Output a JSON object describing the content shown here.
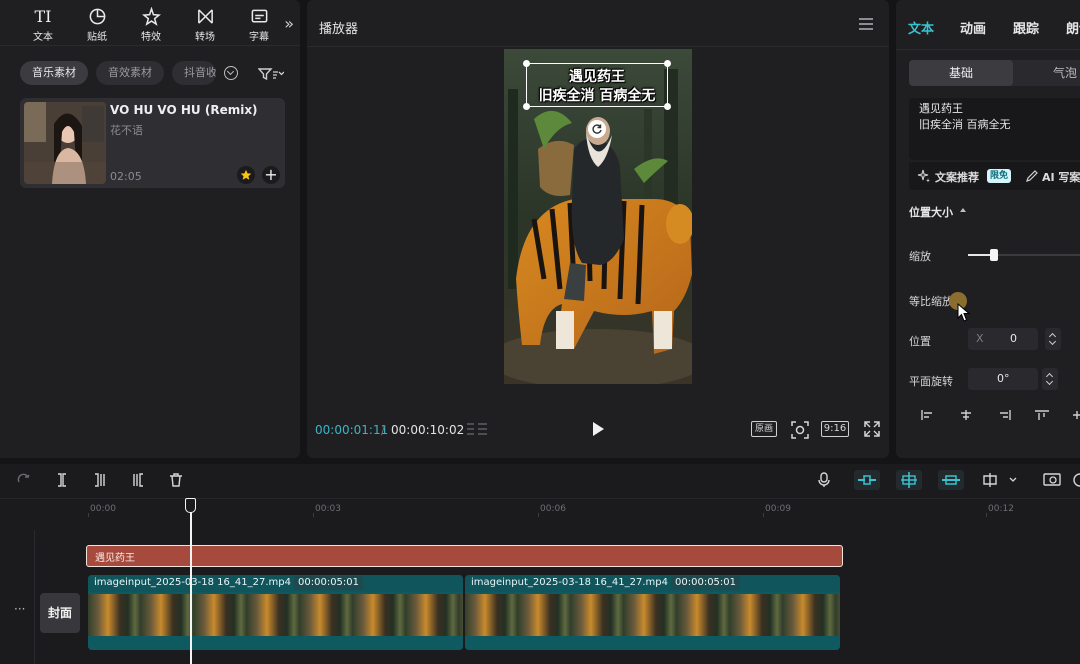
{
  "toolbar": {
    "items": [
      {
        "label": "文本",
        "icon": "text-icon"
      },
      {
        "label": "贴纸",
        "icon": "sticker-icon"
      },
      {
        "label": "特效",
        "icon": "effects-icon"
      },
      {
        "label": "转场",
        "icon": "transition-icon"
      },
      {
        "label": "字幕",
        "icon": "subtitle-icon"
      }
    ],
    "more_icon": "»"
  },
  "media_chips": [
    "音乐素材",
    "音效素材",
    "抖音收"
  ],
  "music": {
    "title": "VO HU VO HU (Remix)",
    "artist": "花不语",
    "duration": "02:05"
  },
  "player": {
    "title": "播放器",
    "caption_line1": "遇见药王",
    "caption_line2": "旧疾全消 百病全无",
    "time_current": "00:00:01:11",
    "time_separator": "/",
    "time_total": "00:00:10:02",
    "original_label": "原画",
    "ratio_label": "9:16"
  },
  "inspector": {
    "tabs": [
      "文本",
      "动画",
      "跟踪",
      "朗读"
    ],
    "sub_tab_basic": "基础",
    "sub_tab_bubble": "气泡",
    "text_line1": "遇见药王",
    "text_line2": "旧疾全消 百病全无",
    "recommend_label": "文案推荐",
    "recommend_badge": "限免",
    "ai_label": "AI 写案",
    "section_position_size": "位置大小",
    "scale_label": "缩放",
    "scale_value": 0.23,
    "uniform_scale_label": "等比缩放",
    "position_label": "位置",
    "position_x_axis": "X",
    "position_x": "0",
    "rotation_label": "平面旋转",
    "rotation_value": "0°"
  },
  "timeline": {
    "ruler": [
      "00:00",
      "00:03",
      "00:06",
      "00:09",
      "00:12"
    ],
    "text_clip": "遇见药王",
    "video_clips": [
      {
        "name": "imageinput_2025-03-18 16_41_27.mp4",
        "duration": "00:00:05:01"
      },
      {
        "name": "imageinput_2025-03-18 16_41_27.mp4",
        "duration": "00:00:05:01"
      }
    ],
    "cover_label": "封面",
    "more_label": "···"
  },
  "colors": {
    "accent": "#3bc1d0",
    "text_clip": "#a64a3e",
    "video_clip": "#0f5a60",
    "panel": "#1f1f22"
  }
}
